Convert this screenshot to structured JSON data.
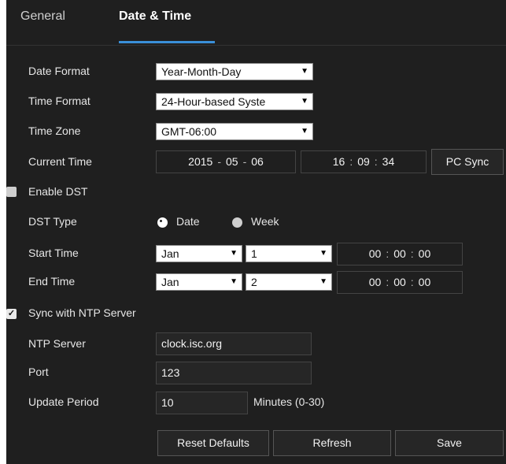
{
  "tabs": {
    "general": "General",
    "datetime": "Date & Time"
  },
  "labels": {
    "date_format": "Date Format",
    "time_format": "Time Format",
    "time_zone": "Time Zone",
    "current_time": "Current Time",
    "enable_dst": "Enable DST",
    "dst_type": "DST Type",
    "start_time": "Start Time",
    "end_time": "End Time",
    "sync_ntp": "Sync with NTP Server",
    "ntp_server": "NTP Server",
    "port": "Port",
    "update_period": "Update Period",
    "minutes_hint": "Minutes (0-30)"
  },
  "values": {
    "date_format": "Year-Month-Day",
    "time_format": "24-Hour-based Syste",
    "time_zone": "GMT-06:00",
    "current_date": {
      "y": "2015",
      "m": "05",
      "d": "06"
    },
    "current_time": {
      "h": "16",
      "mi": "09",
      "s": "34"
    },
    "dst_type_options": {
      "date": "Date",
      "week": "Week"
    },
    "dst_type_selected": "Date",
    "start": {
      "month": "Jan",
      "day": "1",
      "h": "00",
      "mi": "00",
      "s": "00"
    },
    "end": {
      "month": "Jan",
      "day": "2",
      "h": "00",
      "mi": "00",
      "s": "00"
    },
    "ntp_server": "clock.isc.org",
    "port": "123",
    "update_period": "10",
    "enable_dst_checked": false,
    "sync_ntp_checked": true
  },
  "glyphs": {
    "dropdown_arrow": "▼",
    "date_sep": "-",
    "time_sep": ":",
    "check": "✓"
  },
  "buttons": {
    "pc_sync": "PC Sync",
    "reset_defaults": "Reset Defaults",
    "refresh": "Refresh",
    "save": "Save"
  },
  "colors": {
    "background": "#1f1f1f",
    "accent": "#3a8fd8"
  }
}
